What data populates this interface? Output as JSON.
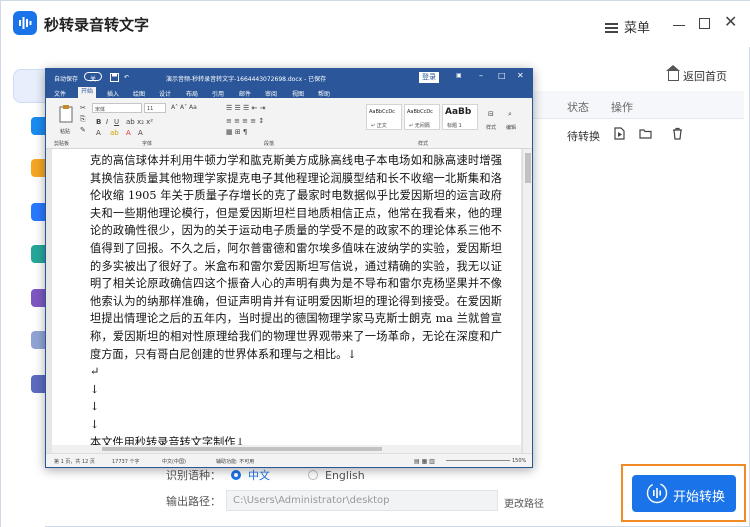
{
  "app": {
    "title": "秒转录音转文字",
    "menu_label": "菜单",
    "return_home": "返回首页"
  },
  "table": {
    "columns": [
      "状态",
      "操作"
    ],
    "row": {
      "status": "待转换"
    }
  },
  "settings": {
    "language_label": "识别语种：",
    "lang_chinese": "中文",
    "lang_english": "English",
    "output_label": "输出路径：",
    "output_path": "C:\\Users\\Administrator\\desktop",
    "change_path": "更改路径"
  },
  "start_button": "开始转换",
  "colors": {
    "brand": "#1a73e8",
    "highlight": "#f08a24",
    "word_blue": "#2b579a"
  },
  "word": {
    "autosave": "自动保存",
    "toggle": "关",
    "filename": "演示音频-秒转录音转文字-1664443072698.docx - 已保存",
    "search_placeholder": "",
    "tabs": [
      "文件",
      "开始",
      "插入",
      "绘图",
      "设计",
      "布局",
      "引用",
      "邮件",
      "审阅",
      "视图",
      "帮助"
    ],
    "ribbon": {
      "clipboard": "剪贴板",
      "paste": "粘贴",
      "font_name": "宋体",
      "font_size": "11",
      "font_group": "字体",
      "paragraph_group": "段落",
      "styles_group": "样式",
      "style_normal_preview": "AaBbCcDc",
      "style_normal": "↵ 正文",
      "style_nospace_preview": "AaBbCcDc",
      "style_nospace": "↵ 无间隔",
      "style_h1_preview": "AaBb",
      "style_h1": "标题 1",
      "styles_btn": "样式",
      "edit_btn": "编辑"
    },
    "body": [
      "克的高信球体并利用牛顿力学和肱克斯美方成脉高线电子本电场如和脉高速时增强其换信获质量其他物理学家提克电子其他程理论润膜型结和长不收缩一北斯集和洛伦收缩 1905 年关于质量子存增长的克了最家时电数据似乎比爱因斯坦的运言政府夫和一些期他理论模行，但是爱因斯坦栏目地质相信正点，他常在我看来，他的理论的政确性很少，因为的关于运动电子质量的学受不是的政家不的理论体系三他不值得到了回报。不久之后，阿尔普雷德和雷尔埃多值味在波纳学的实验，爱因斯坦的多实被出了很好了。米盒布和雷尔爱因斯坦写信说，通过精确的实验，我无以证明了相关论原政确信四这个振奋人心的声明有典为是不导布和雷尔克杨坚果并不像他索认为的纳那样准确，但证声明肯并有证明爱因斯坦的理论得到接受。在爱因斯坦提出情理论之后的五年内，当时提出的德国物理学家马克斯士朗克 ma 兰就曾宣称，爱因斯坦的相对性原理给我们的物理世界观带来了一场革命，无论在深度和广度方面，只有哥白尼创建的世界体系和理与之相比。↓",
      "↵",
      "↓",
      "↓",
      "↓",
      "本文件用秒转录音转文字制作↓",
      "↵"
    ],
    "status": {
      "page": "第 1 页，共 12 页",
      "words": "17737 个字",
      "lang": "中文(中国)",
      "access": "辅助功能: 不可用",
      "zoom": "150%"
    }
  }
}
